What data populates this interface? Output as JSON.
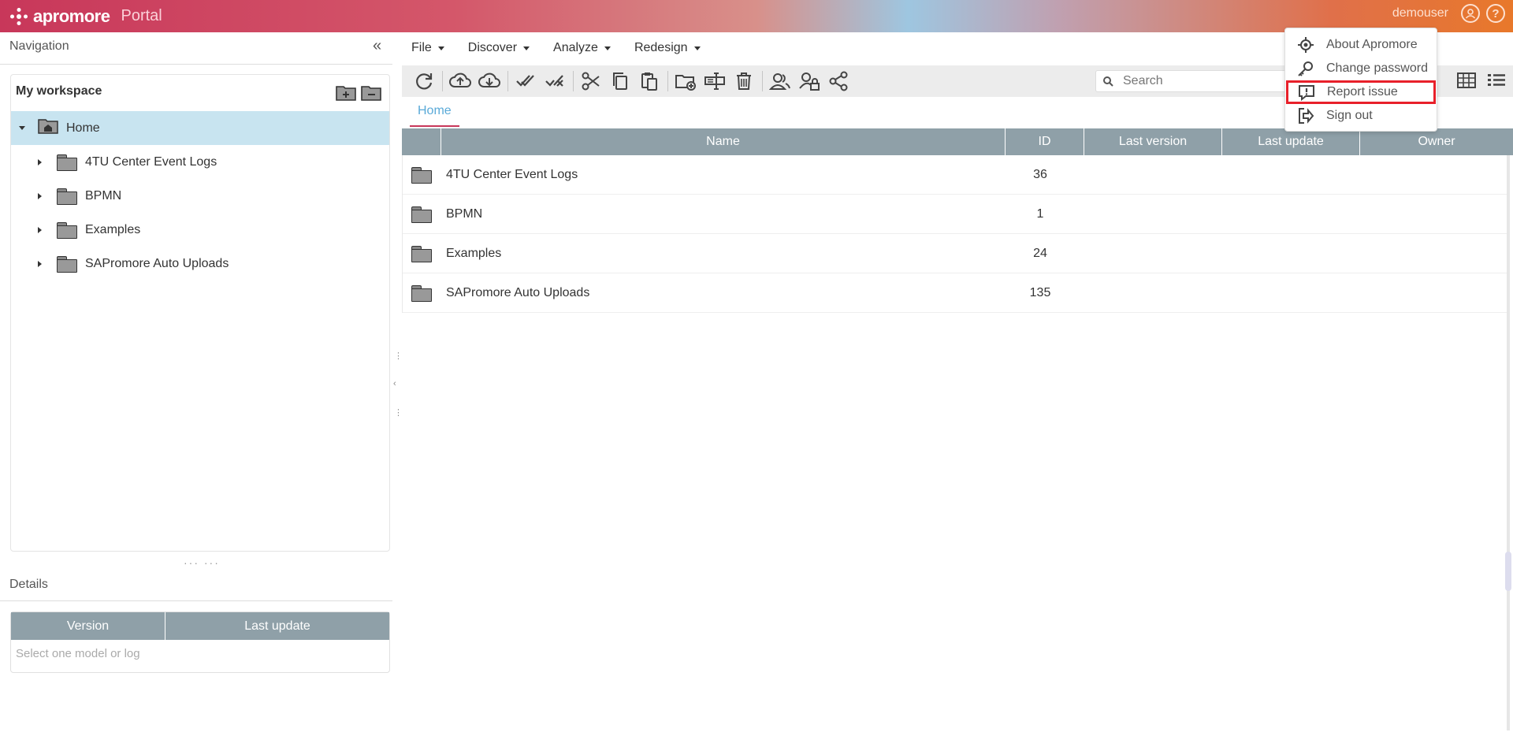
{
  "header": {
    "brand": "apromore",
    "portal": "Portal",
    "username": "demouser"
  },
  "nav": {
    "title": "Navigation",
    "collapse": "«",
    "workspace_title": "My workspace",
    "tree": [
      {
        "label": "Home",
        "selected": true,
        "expanded": true,
        "level": 0
      },
      {
        "label": "4TU Center Event Logs",
        "level": 1
      },
      {
        "label": "BPMN",
        "level": 1
      },
      {
        "label": "Examples",
        "level": 1
      },
      {
        "label": "SAPromore Auto Uploads",
        "level": 1
      }
    ]
  },
  "details": {
    "title": "Details",
    "columns": [
      "Version",
      "Last update"
    ],
    "empty": "Select one model or log"
  },
  "menubar": [
    {
      "label": "File"
    },
    {
      "label": "Discover"
    },
    {
      "label": "Analyze"
    },
    {
      "label": "Redesign"
    }
  ],
  "toolbar": {
    "icons": [
      "refresh-icon",
      "upload-icon",
      "download-icon",
      "select-all-icon",
      "deselect-icon",
      "cut-icon",
      "copy-icon",
      "paste-icon",
      "new-folder-icon",
      "rename-icon",
      "delete-icon",
      "users-icon",
      "user-lock-icon",
      "share-icon"
    ],
    "search_placeholder": "Search"
  },
  "breadcrumb": {
    "home": "Home"
  },
  "grid": {
    "columns": [
      "Name",
      "ID",
      "Last version",
      "Last update",
      "Owner"
    ],
    "rows": [
      {
        "name": "4TU Center Event Logs",
        "id": "36"
      },
      {
        "name": "BPMN",
        "id": "1"
      },
      {
        "name": "Examples",
        "id": "24"
      },
      {
        "name": "SAPromore Auto Uploads",
        "id": "135"
      }
    ]
  },
  "user_menu": {
    "items": [
      {
        "label": "About Apromore",
        "icon": "target-icon"
      },
      {
        "label": "Change password",
        "icon": "key-icon"
      },
      {
        "label": "Report issue",
        "icon": "alert-icon",
        "highlighted": true
      },
      {
        "label": "Sign out",
        "icon": "sign-out-icon"
      }
    ]
  },
  "colors": {
    "header_start": "#c8375a",
    "header_end": "#e8782a",
    "grid_header": "#8fa0a8",
    "selection": "#c8e4f0",
    "highlight_border": "#e8202a",
    "link": "#5aaad8"
  }
}
